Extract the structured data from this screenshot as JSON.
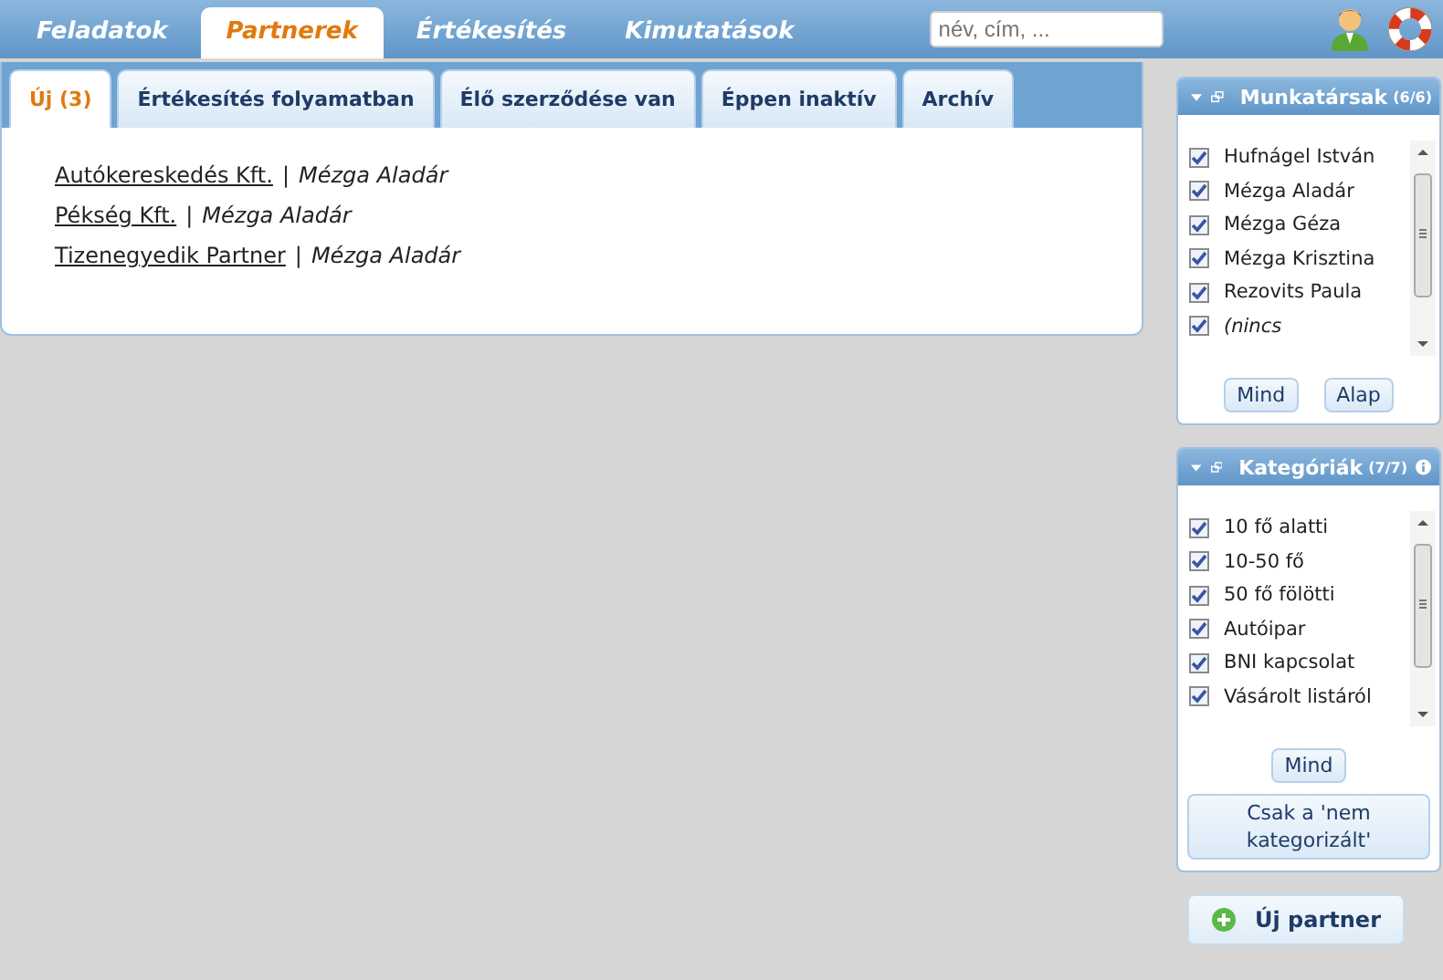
{
  "nav": {
    "tabs": [
      {
        "label": "Feladatok",
        "selected": false
      },
      {
        "label": "Partnerek",
        "selected": true
      },
      {
        "label": "Értékesítés",
        "selected": false
      },
      {
        "label": "Kimutatások",
        "selected": false
      }
    ],
    "search": {
      "placeholder": "név, cím, ..."
    }
  },
  "subtabs": [
    {
      "label": "Új (3)",
      "selected": true
    },
    {
      "label": "Értékesítés folyamatban",
      "selected": false
    },
    {
      "label": "Élő szerződése van",
      "selected": false
    },
    {
      "label": "Éppen inaktív",
      "selected": false
    },
    {
      "label": "Archív",
      "selected": false
    }
  ],
  "partners": [
    {
      "name": "Autókereskedés Kft.",
      "separator": "|",
      "owner": "Mézga Aladár"
    },
    {
      "name": "Pékség Kft.",
      "separator": "|",
      "owner": "Mézga Aladár"
    },
    {
      "name": "Tizenegyedik Partner",
      "separator": "|",
      "owner": "Mézga Aladár"
    }
  ],
  "panels": [
    {
      "title": "Munkatársak",
      "count": "(6/6)",
      "info": false,
      "items": [
        {
          "label": "Hufnágel István",
          "checked": true,
          "italic": false
        },
        {
          "label": "Mézga Aladár",
          "checked": true,
          "italic": false
        },
        {
          "label": "Mézga Géza",
          "checked": true,
          "italic": false
        },
        {
          "label": "Mézga Krisztina",
          "checked": true,
          "italic": false
        },
        {
          "label": "Rezovits Paula",
          "checked": true,
          "italic": false
        },
        {
          "label": "(nincs",
          "checked": true,
          "italic": true
        }
      ],
      "buttons": [
        "Mind",
        "Alap"
      ]
    },
    {
      "title": "Kategóriák",
      "count": "(7/7)",
      "info": true,
      "items": [
        {
          "label": "10 fő alatti",
          "checked": true,
          "italic": false
        },
        {
          "label": "10-50 fő",
          "checked": true,
          "italic": false
        },
        {
          "label": "50 fő fölötti",
          "checked": true,
          "italic": false
        },
        {
          "label": "Autóipar",
          "checked": true,
          "italic": false
        },
        {
          "label": "BNI kapcsolat",
          "checked": true,
          "italic": false
        },
        {
          "label": "Vásárolt listáról",
          "checked": true,
          "italic": false
        }
      ],
      "buttons": [
        "Mind"
      ],
      "wide_button": "Csak a 'nem kategorizált'"
    }
  ],
  "new_button": "Új partner"
}
